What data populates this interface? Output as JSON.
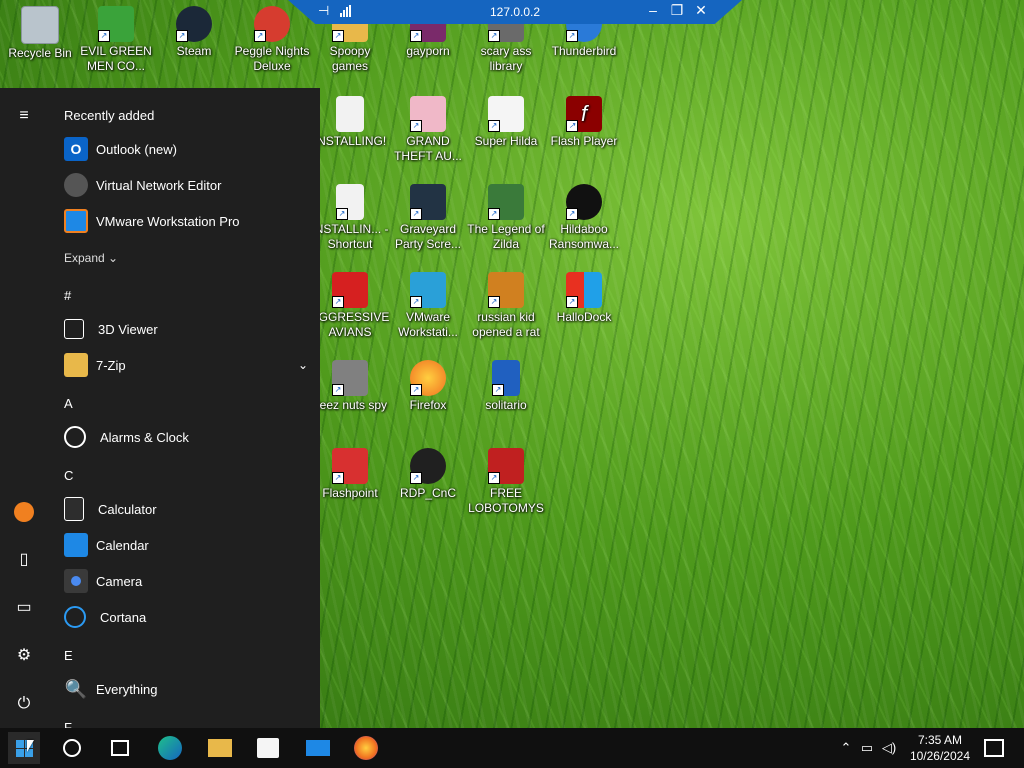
{
  "rdp": {
    "host": "127.0.0.2"
  },
  "desktop_icons": [
    {
      "label": "Recycle Bin",
      "icon": "recycle-bin-icon",
      "color": "#b9c4cc"
    },
    {
      "label": "EVIL GREEN MEN CO...",
      "icon": "green-men-icon",
      "color": "#3aa33a"
    },
    {
      "label": "Steam",
      "icon": "steam-icon",
      "color": "#1b2838"
    },
    {
      "label": "Peggle Nights Deluxe",
      "icon": "peggle-icon",
      "color": "#d63c2f"
    },
    {
      "label": "Spoopy games",
      "icon": "folder-shortcut-icon",
      "color": "#e8b84a"
    },
    {
      "label": "gayporn",
      "icon": "shortcut-icon",
      "color": "#7a2a6a"
    },
    {
      "label": "scary ass library",
      "icon": "library-icon",
      "color": "#6a6a6a"
    },
    {
      "label": "Thunderbird",
      "icon": "thunderbird-icon",
      "color": "#2a7ad8"
    },
    {
      "label": "INSTALLING!",
      "icon": "document-icon",
      "color": "#f2f2f2"
    },
    {
      "label": "GRAND THEFT AU...",
      "icon": "anime-girl-icon",
      "color": "#f0b8c8"
    },
    {
      "label": "Super Hilda",
      "icon": "pixel-dog-icon",
      "color": "#f5f5f5"
    },
    {
      "label": "Flash Player",
      "icon": "flash-icon",
      "color": "#8b0000"
    },
    {
      "label": "INSTALLIN... - Shortcut",
      "icon": "document-icon",
      "color": "#f2f2f2"
    },
    {
      "label": "Graveyard Party Scre...",
      "icon": "graveyard-icon",
      "color": "#223344"
    },
    {
      "label": "The Legend of Zilda",
      "icon": "zilda-icon",
      "color": "#3a7a3a"
    },
    {
      "label": "Hildaboo Ransomwa...",
      "icon": "ransomware-icon",
      "color": "#111111"
    },
    {
      "label": "AGGRESSIVE AVIANS",
      "icon": "angry-bird-icon",
      "color": "#d62020"
    },
    {
      "label": "VMware Workstati...",
      "icon": "vmware-icon",
      "color": "#2aa0d8"
    },
    {
      "label": "russian kid opened a rat",
      "icon": "rat-icon",
      "color": "#d08020"
    },
    {
      "label": "HalloDock",
      "icon": "shield-icon",
      "color": "#e8c020"
    },
    {
      "label": "deez nuts spy",
      "icon": "window-stack-icon",
      "color": "#808080"
    },
    {
      "label": "Firefox",
      "icon": "firefox-icon",
      "color": "#f07020"
    },
    {
      "label": "solitario",
      "icon": "solitaire-icon",
      "color": "#2060c0"
    },
    {
      "label": "Flashpoint",
      "icon": "flashpoint-icon",
      "color": "#d83030"
    },
    {
      "label": "RDP_CnC",
      "icon": "rdp-icon",
      "color": "#202020"
    },
    {
      "label": "FREE LOBOTOMYS",
      "icon": "lobotomy-icon",
      "color": "#c02020"
    }
  ],
  "start_menu": {
    "recently_added_title": "Recently added",
    "recent": [
      {
        "label": "Outlook (new)",
        "icon": "outlook-icon",
        "color": "#0a64c8"
      },
      {
        "label": "Virtual Network Editor",
        "icon": "network-editor-icon",
        "color": "#555555"
      },
      {
        "label": "VMware Workstation Pro",
        "icon": "vmware-icon",
        "color": "#1e88e5"
      }
    ],
    "expand_label": "Expand",
    "apps": [
      {
        "type": "header",
        "label": "#"
      },
      {
        "type": "app",
        "label": "3D Viewer",
        "icon": "cube-icon",
        "color": "#1f1f1f"
      },
      {
        "type": "app",
        "label": "7-Zip",
        "icon": "folder-icon",
        "color": "#e8b84a",
        "chevron": true
      },
      {
        "type": "header",
        "label": "A"
      },
      {
        "type": "app",
        "label": "Alarms & Clock",
        "icon": "clock-icon",
        "color": "#1f1f1f"
      },
      {
        "type": "header",
        "label": "C"
      },
      {
        "type": "app",
        "label": "Calculator",
        "icon": "calculator-icon",
        "color": "#2d2d2d"
      },
      {
        "type": "app",
        "label": "Calendar",
        "icon": "calendar-icon",
        "color": "#1e88e5"
      },
      {
        "type": "app",
        "label": "Camera",
        "icon": "camera-icon",
        "color": "#3a3a3a"
      },
      {
        "type": "app",
        "label": "Cortana",
        "icon": "cortana-icon",
        "color": "#1f1f1f"
      },
      {
        "type": "header",
        "label": "E"
      },
      {
        "type": "app",
        "label": "Everything",
        "icon": "magnifier-icon",
        "color": "#1f1f1f"
      },
      {
        "type": "header",
        "label": "F"
      }
    ],
    "rail": [
      {
        "name": "hamburger-menu-icon",
        "glyph": "≡"
      },
      {
        "name": "user-avatar-icon",
        "glyph": "●"
      },
      {
        "name": "documents-icon",
        "glyph": "🗋"
      },
      {
        "name": "pictures-icon",
        "glyph": "🖼"
      },
      {
        "name": "settings-gear-icon",
        "glyph": "⚙"
      },
      {
        "name": "power-icon",
        "glyph": "⏻"
      }
    ]
  },
  "taskbar": {
    "items": [
      {
        "name": "start-button",
        "icon": "windows-logo-icon"
      },
      {
        "name": "search-button",
        "icon": "search-icon"
      },
      {
        "name": "task-view-button",
        "icon": "task-view-icon"
      },
      {
        "name": "edge-button",
        "icon": "edge-icon"
      },
      {
        "name": "file-explorer-button",
        "icon": "folder-icon"
      },
      {
        "name": "store-button",
        "icon": "store-icon"
      },
      {
        "name": "mail-button",
        "icon": "mail-icon"
      },
      {
        "name": "firefox-button",
        "icon": "firefox-icon"
      }
    ],
    "time": "7:35 AM",
    "date": "10/26/2024"
  },
  "colors": {
    "taskbar": "#101010",
    "start_menu": "#1f1f1f",
    "rdp_bar": "#1565c0",
    "accent": "#0078d4"
  }
}
